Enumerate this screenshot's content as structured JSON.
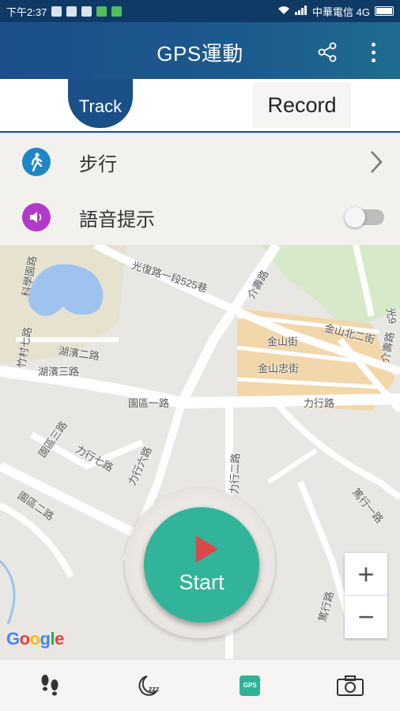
{
  "status_bar": {
    "time": "下午2:37",
    "carrier": "中華電信 4G"
  },
  "app_bar": {
    "title": "GPS運動",
    "share_icon": "share-icon",
    "menu_icon": "more-vert-icon"
  },
  "tabs": {
    "track_label": "Track",
    "record_label": "Record",
    "selected": "Track"
  },
  "settings": {
    "activity": {
      "label": "步行",
      "icon": "walking-icon",
      "icon_color": "#1f86c6"
    },
    "voice": {
      "label": "語音提示",
      "icon": "speaker-icon",
      "icon_color": "#b13ac9",
      "enabled": false
    }
  },
  "map": {
    "labels": [
      "光復路一段525巷",
      "介壽路",
      "金山街",
      "金山北二街",
      "金山忠街",
      "湖濱二路",
      "湖濱三路",
      "竹村七路",
      "園區一路",
      "力行路",
      "園區三路",
      "力行七路",
      "力行六路",
      "力行二路",
      "園區二路",
      "篤行一路",
      "篤行路",
      "科學園路",
      "介壽路",
      "光9"
    ],
    "attribution": "Google",
    "zoom_in": "+",
    "zoom_out": "−"
  },
  "start_button": {
    "label": "Start",
    "accent": "#31b49a",
    "play_color": "#d9484a"
  },
  "bottom_nav": [
    {
      "name": "footsteps-icon"
    },
    {
      "name": "sleep-zzz-icon"
    },
    {
      "name": "gps-icon",
      "label": "GPS",
      "active": true
    },
    {
      "name": "camera-icon"
    }
  ]
}
